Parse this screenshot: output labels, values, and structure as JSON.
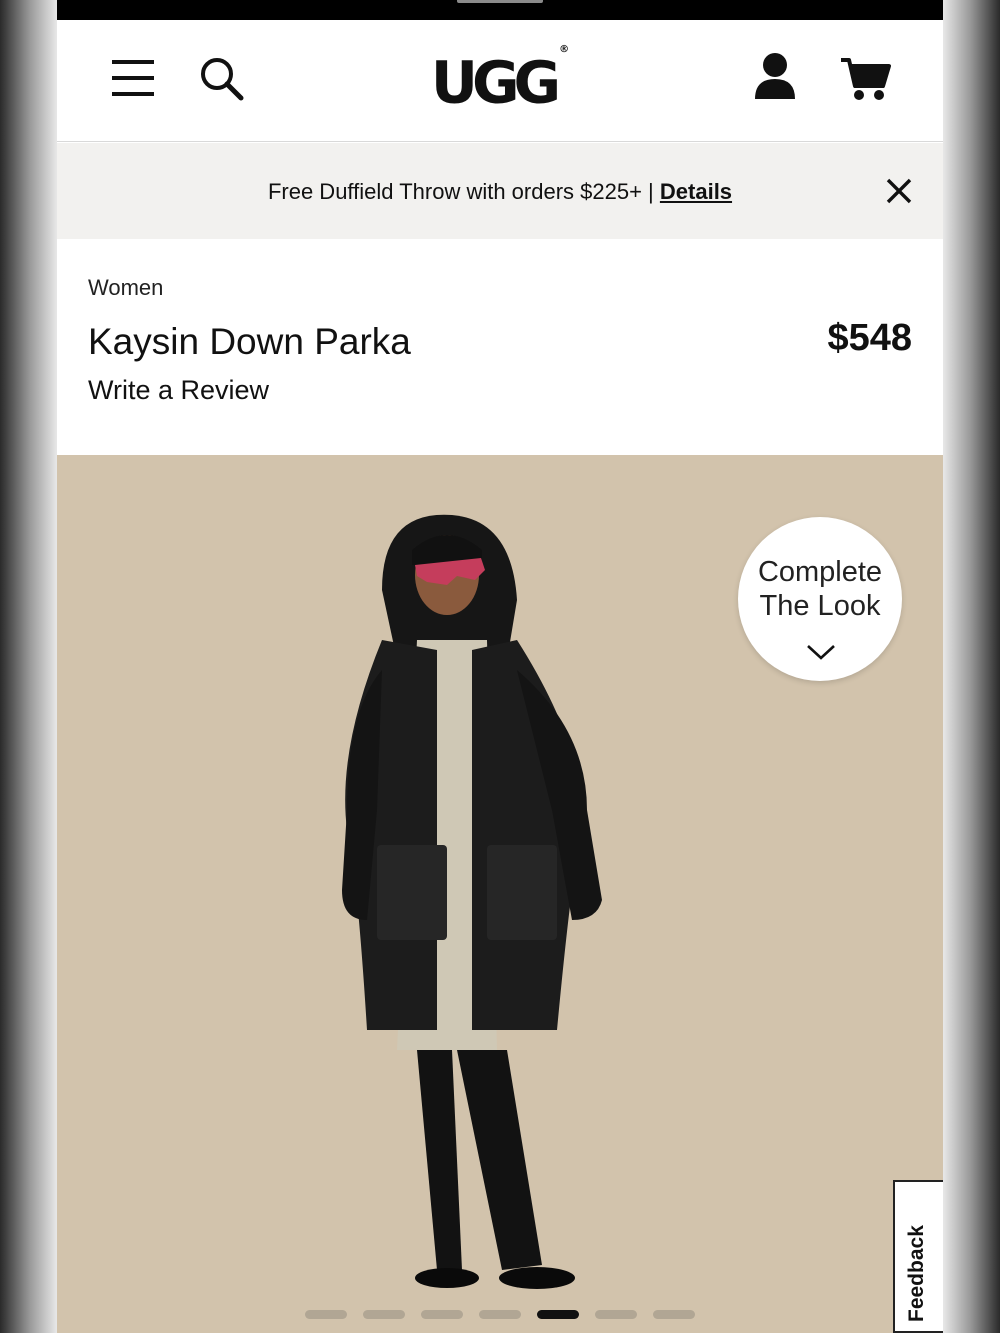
{
  "header": {
    "logo_text": "UGG",
    "logo_mark": "®",
    "icons": [
      "hamburger-menu-icon",
      "search-icon",
      "account-icon",
      "cart-icon"
    ]
  },
  "promo": {
    "text": "Free Duffield Throw with orders $225+ | ",
    "link": "Details",
    "close": "×"
  },
  "product": {
    "category": "Women",
    "title": "Kaysin Down Parka",
    "review_link": "Write a Review",
    "price": "$548"
  },
  "gallery": {
    "complete_look_line1": "Complete",
    "complete_look_line2": "The Look",
    "slide_count": 7,
    "active_slide": 5,
    "background_color": "#d2c3ac"
  },
  "feedback": {
    "label": "Feedback"
  }
}
